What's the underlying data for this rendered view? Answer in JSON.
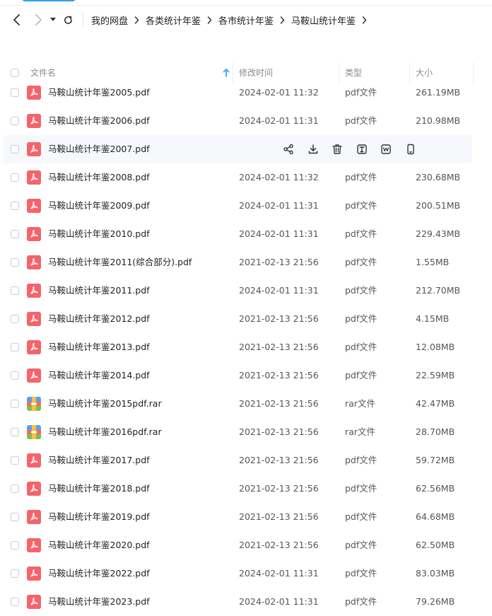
{
  "breadcrumb": [
    "我的网盘",
    "各类统计年鉴",
    "各市统计年鉴",
    "马鞍山统计年鉴"
  ],
  "columns": {
    "name": "文件名",
    "modified": "修改时间",
    "type": "类型",
    "size": "大小"
  },
  "colors": {
    "pdf": "#f4646a",
    "accent": "#2a9df4"
  },
  "rows": [
    {
      "name": "马鞍山统计年鉴2005.pdf",
      "time": "2024-02-01 11:32",
      "type": "pdf文件",
      "size": "261.19MB",
      "icon": "pdf"
    },
    {
      "name": "马鞍山统计年鉴2006.pdf",
      "time": "2024-02-01 11:31",
      "type": "pdf文件",
      "size": "210.98MB",
      "icon": "pdf"
    },
    {
      "name": "马鞍山统计年鉴2007.pdf",
      "time": "",
      "type": "",
      "size": "",
      "icon": "pdf",
      "hover": true
    },
    {
      "name": "马鞍山统计年鉴2008.pdf",
      "time": "2024-02-01 11:32",
      "type": "pdf文件",
      "size": "230.68MB",
      "icon": "pdf"
    },
    {
      "name": "马鞍山统计年鉴2009.pdf",
      "time": "2024-02-01 11:31",
      "type": "pdf文件",
      "size": "200.51MB",
      "icon": "pdf"
    },
    {
      "name": "马鞍山统计年鉴2010.pdf",
      "time": "2024-02-01 11:31",
      "type": "pdf文件",
      "size": "229.43MB",
      "icon": "pdf"
    },
    {
      "name": "马鞍山统计年鉴2011(综合部分).pdf",
      "time": "2021-02-13 21:56",
      "type": "pdf文件",
      "size": "1.55MB",
      "icon": "pdf"
    },
    {
      "name": "马鞍山统计年鉴2011.pdf",
      "time": "2024-02-01 11:31",
      "type": "pdf文件",
      "size": "212.70MB",
      "icon": "pdf"
    },
    {
      "name": "马鞍山统计年鉴2012.pdf",
      "time": "2021-02-13 21:56",
      "type": "pdf文件",
      "size": "4.15MB",
      "icon": "pdf"
    },
    {
      "name": "马鞍山统计年鉴2013.pdf",
      "time": "2021-02-13 21:56",
      "type": "pdf文件",
      "size": "12.08MB",
      "icon": "pdf"
    },
    {
      "name": "马鞍山统计年鉴2014.pdf",
      "time": "2021-02-13 21:56",
      "type": "pdf文件",
      "size": "22.59MB",
      "icon": "pdf"
    },
    {
      "name": "马鞍山统计年鉴2015pdf.rar",
      "time": "2021-02-13 21:56",
      "type": "rar文件",
      "size": "42.47MB",
      "icon": "rar"
    },
    {
      "name": "马鞍山统计年鉴2016pdf.rar",
      "time": "2021-02-13 21:56",
      "type": "rar文件",
      "size": "28.70MB",
      "icon": "rar"
    },
    {
      "name": "马鞍山统计年鉴2017.pdf",
      "time": "2021-02-13 21:56",
      "type": "pdf文件",
      "size": "59.72MB",
      "icon": "pdf"
    },
    {
      "name": "马鞍山统计年鉴2018.pdf",
      "time": "2021-02-13 21:56",
      "type": "pdf文件",
      "size": "62.56MB",
      "icon": "pdf"
    },
    {
      "name": "马鞍山统计年鉴2019.pdf",
      "time": "2021-02-13 21:56",
      "type": "pdf文件",
      "size": "64.68MB",
      "icon": "pdf"
    },
    {
      "name": "马鞍山统计年鉴2020.pdf",
      "time": "2021-02-13 21:56",
      "type": "pdf文件",
      "size": "62.50MB",
      "icon": "pdf"
    },
    {
      "name": "马鞍山统计年鉴2022.pdf",
      "time": "2024-02-01 11:31",
      "type": "pdf文件",
      "size": "83.03MB",
      "icon": "pdf"
    },
    {
      "name": "马鞍山统计年鉴2023.pdf",
      "time": "2024-02-01 11:31",
      "type": "pdf文件",
      "size": "79.26MB",
      "icon": "pdf"
    }
  ],
  "hover_actions": [
    "share-icon",
    "download-icon",
    "delete-icon",
    "text-info-icon",
    "word-convert-icon",
    "phone-icon"
  ]
}
